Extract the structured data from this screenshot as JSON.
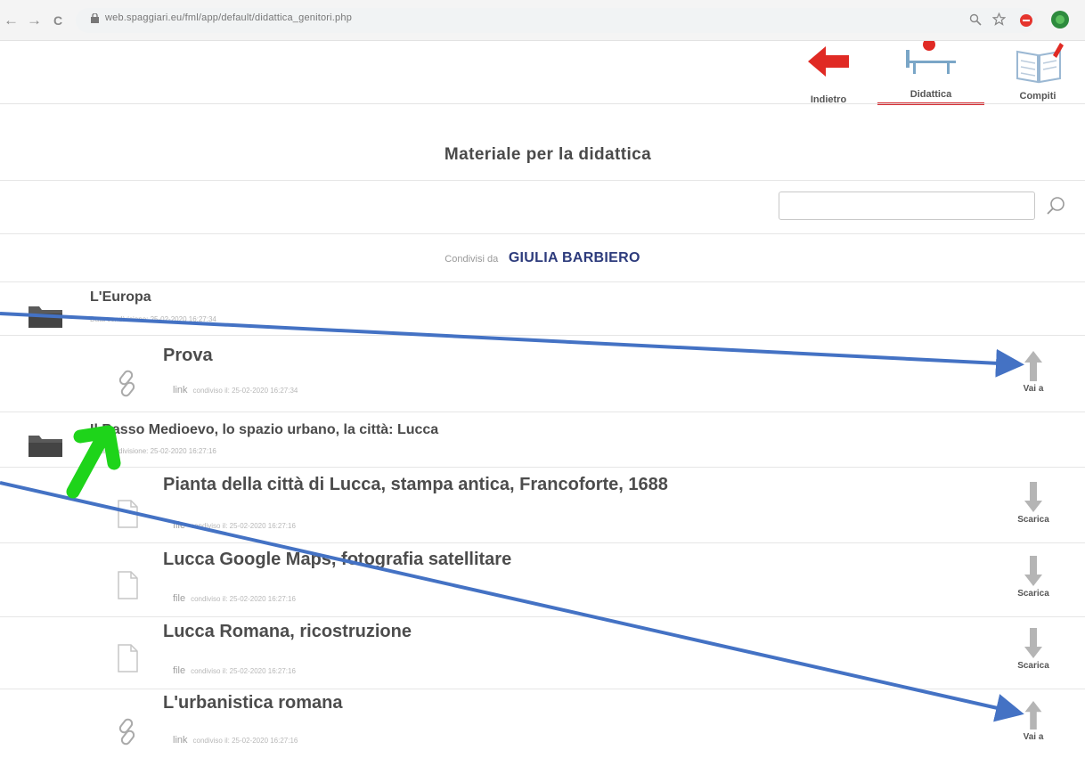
{
  "browser": {
    "back_glyph": "←",
    "forward_glyph": "→",
    "reload_glyph": "C",
    "url": "web.spaggiari.eu/fml/app/default/didattica_genitori.php",
    "zoom_icon": "search-icon",
    "star_icon": "star-icon"
  },
  "topnav": {
    "back_label": "Indietro",
    "didattica_label": "Didattica",
    "compiti_label": "Compiti"
  },
  "page": {
    "title": "Materiale per la didattica"
  },
  "search": {
    "value": ""
  },
  "shared": {
    "label": "Condivisi da",
    "name": "GIULIA BARBIERO"
  },
  "folders": [
    {
      "title": "L'Europa",
      "meta": "Data condivisione: 25-02-2020 16:27:34",
      "items": [
        {
          "title": "Prova",
          "kind": "link",
          "meta": "condiviso il: 25-02-2020 16:27:34",
          "action": "Vai a",
          "icon": "link-icon"
        }
      ]
    },
    {
      "title": "Il Basso Medioevo, lo spazio urbano, la città: Lucca",
      "meta": "Data condivisione: 25-02-2020 16:27:16",
      "items": [
        {
          "title": "Pianta della città di Lucca, stampa antica, Francoforte, 1688",
          "kind": "file",
          "meta": "condiviso il: 25-02-2020 16:27:16",
          "action": "Scarica",
          "icon": "file-icon"
        },
        {
          "title": "Lucca Google Maps, fotografia satellitare",
          "kind": "file",
          "meta": "condiviso il: 25-02-2020 16:27:16",
          "action": "Scarica",
          "icon": "file-icon"
        },
        {
          "title": "Lucca Romana, ricostruzione",
          "kind": "file",
          "meta": "condiviso il: 25-02-2020 16:27:16",
          "action": "Scarica",
          "icon": "file-icon"
        },
        {
          "title": "L'urbanistica romana",
          "kind": "link",
          "meta": "condiviso il: 25-02-2020 16:27:16",
          "action": "Vai a",
          "icon": "link-icon"
        }
      ]
    }
  ],
  "colors": {
    "accent_red": "#d3262c",
    "name_blue": "#2d3b7c",
    "annotation_blue": "#4472c4",
    "annotation_green": "#1ed41a"
  }
}
